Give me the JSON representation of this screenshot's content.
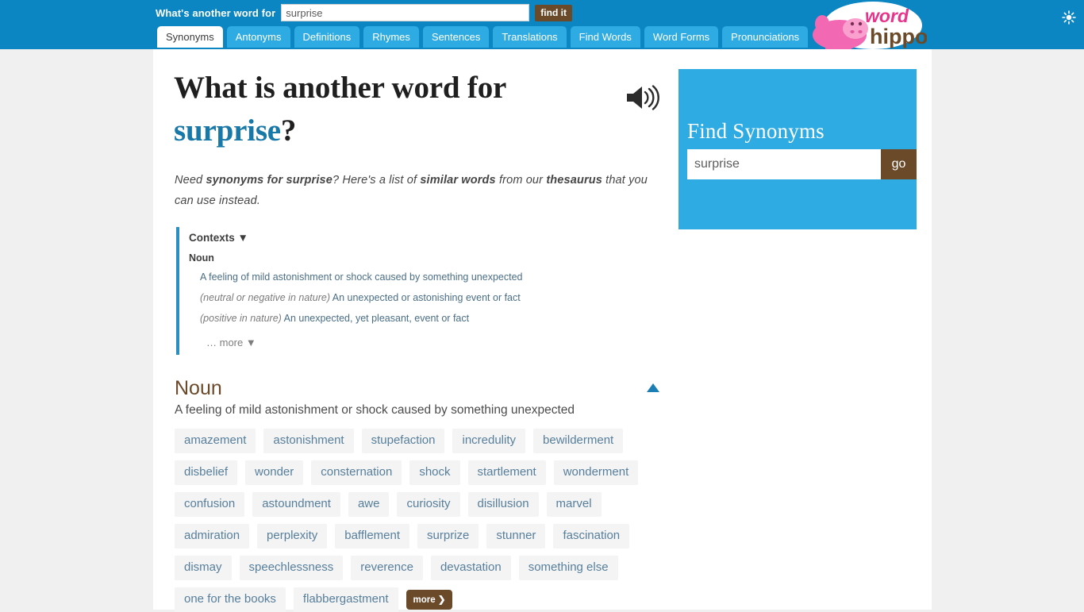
{
  "header": {
    "search_label": "What's another word for",
    "search_value": "surprise",
    "search_placeholder": "",
    "find_button": "find it",
    "brightness_icon": "sun-icon",
    "accent_blue": "#0c86c2",
    "tab_blue": "#2eabe2",
    "brown": "#6b4a2a"
  },
  "logo": {
    "word": "word",
    "hippo": "hippo",
    "word_color": "#e8338a",
    "hippo_color": "#6b4a2a",
    "hippo_body_color": "#f268b3"
  },
  "tabs": [
    {
      "label": "Synonyms",
      "active": true
    },
    {
      "label": "Antonyms",
      "active": false
    },
    {
      "label": "Definitions",
      "active": false
    },
    {
      "label": "Rhymes",
      "active": false
    },
    {
      "label": "Sentences",
      "active": false
    },
    {
      "label": "Translations",
      "active": false
    },
    {
      "label": "Find Words",
      "active": false
    },
    {
      "label": "Word Forms",
      "active": false
    },
    {
      "label": "Pronunciations",
      "active": false
    }
  ],
  "main": {
    "headline_prefix": "What is another word for",
    "headline_word": "surprise",
    "headline_suffix": "?",
    "speaker_icon": "speaker-icon",
    "blurb": {
      "p1": "Need ",
      "b1": "synonyms for surprise",
      "p2": "? Here's a list of ",
      "b2": "similar words",
      "p3": " from our ",
      "b3": "thesaurus",
      "p4": " that you can use instead."
    },
    "contexts": {
      "title": "Contexts",
      "title_caret": "▼",
      "pos": "Noun",
      "lines": [
        {
          "note": "",
          "text": "A feeling of mild astonishment or shock caused by something unexpected"
        },
        {
          "note": "(neutral or negative in nature)",
          "text": " An unexpected or astonishing event or fact"
        },
        {
          "note": "(positive in nature)",
          "text": " An unexpected, yet pleasant, event or fact"
        }
      ],
      "more": "… more ▼"
    },
    "section": {
      "title": "Noun",
      "definition": "A feeling of mild astonishment or shock caused by something unexpected",
      "collapse_icon": "triangle-up-icon",
      "more_label": "more ❯",
      "synonyms": [
        "amazement",
        "astonishment",
        "stupefaction",
        "incredulity",
        "bewilderment",
        "disbelief",
        "wonder",
        "consternation",
        "shock",
        "startlement",
        "wonderment",
        "confusion",
        "astoundment",
        "awe",
        "curiosity",
        "disillusion",
        "marvel",
        "admiration",
        "perplexity",
        "bafflement",
        "surprize",
        "stunner",
        "fascination",
        "dismay",
        "speechlessness",
        "reverence",
        "devastation",
        "something else",
        "one for the books",
        "flabbergastment"
      ]
    }
  },
  "sidebar": {
    "title": "Find Synonyms",
    "input_value": "surprise",
    "input_placeholder": "",
    "go_label": "go"
  }
}
